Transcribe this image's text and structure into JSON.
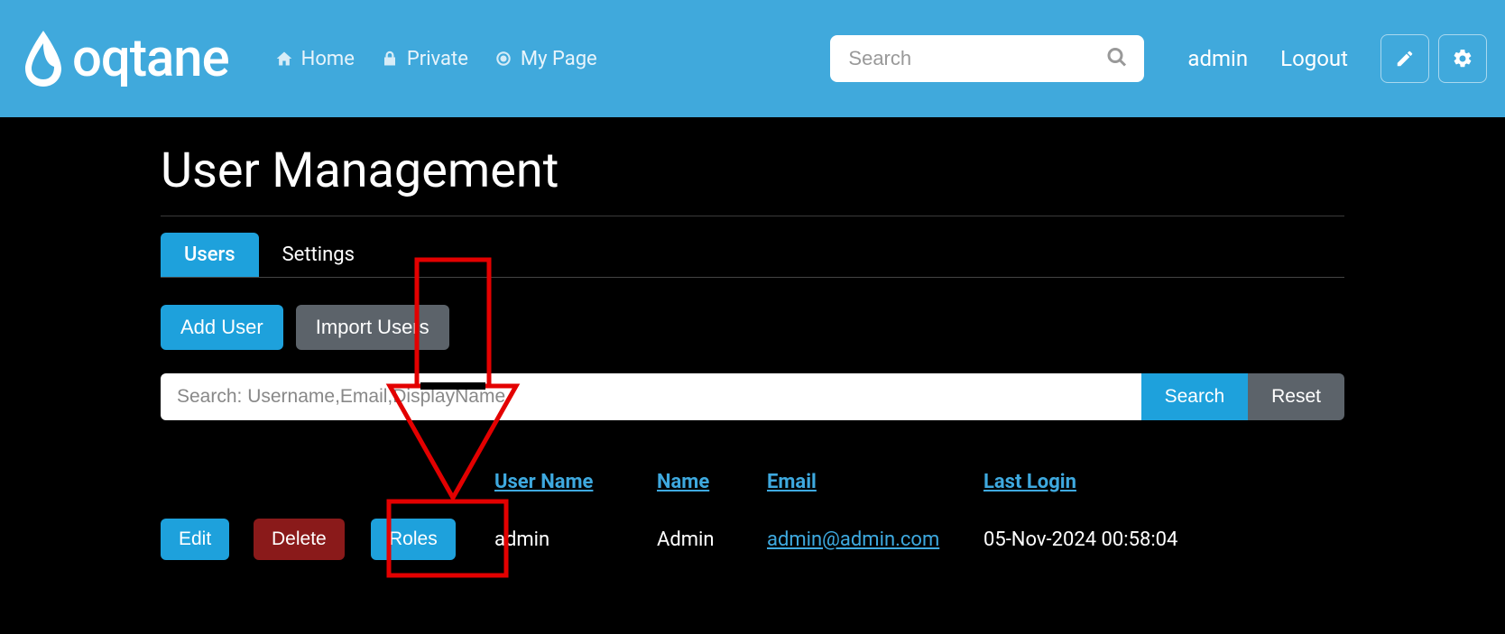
{
  "brand": {
    "name": "oqtane"
  },
  "nav": {
    "items": [
      {
        "label": "Home",
        "icon": "home"
      },
      {
        "label": "Private",
        "icon": "lock"
      },
      {
        "label": "My Page",
        "icon": "target"
      }
    ]
  },
  "search": {
    "placeholder": "Search"
  },
  "userMenu": {
    "username": "admin",
    "logout": "Logout"
  },
  "page": {
    "title": "User Management",
    "tabs": [
      {
        "label": "Users",
        "active": true
      },
      {
        "label": "Settings",
        "active": false
      }
    ],
    "actions": {
      "add": "Add User",
      "import": "Import Users"
    },
    "filter": {
      "placeholder": "Search: Username,Email,DisplayName",
      "search": "Search",
      "reset": "Reset"
    },
    "table": {
      "headers": {
        "username": "User Name",
        "name": "Name",
        "email": "Email",
        "lastlogin": "Last Login"
      },
      "rowActions": {
        "edit": "Edit",
        "delete": "Delete",
        "roles": "Roles"
      },
      "rows": [
        {
          "username": "admin",
          "name": "Admin",
          "email": "admin@admin.com",
          "lastlogin": "05-Nov-2024 00:58:04"
        }
      ]
    }
  },
  "colors": {
    "accent": "#1ea1dc",
    "headerbar": "#40a9dc",
    "danger": "#8a1a1a",
    "annotation": "#e30000"
  }
}
